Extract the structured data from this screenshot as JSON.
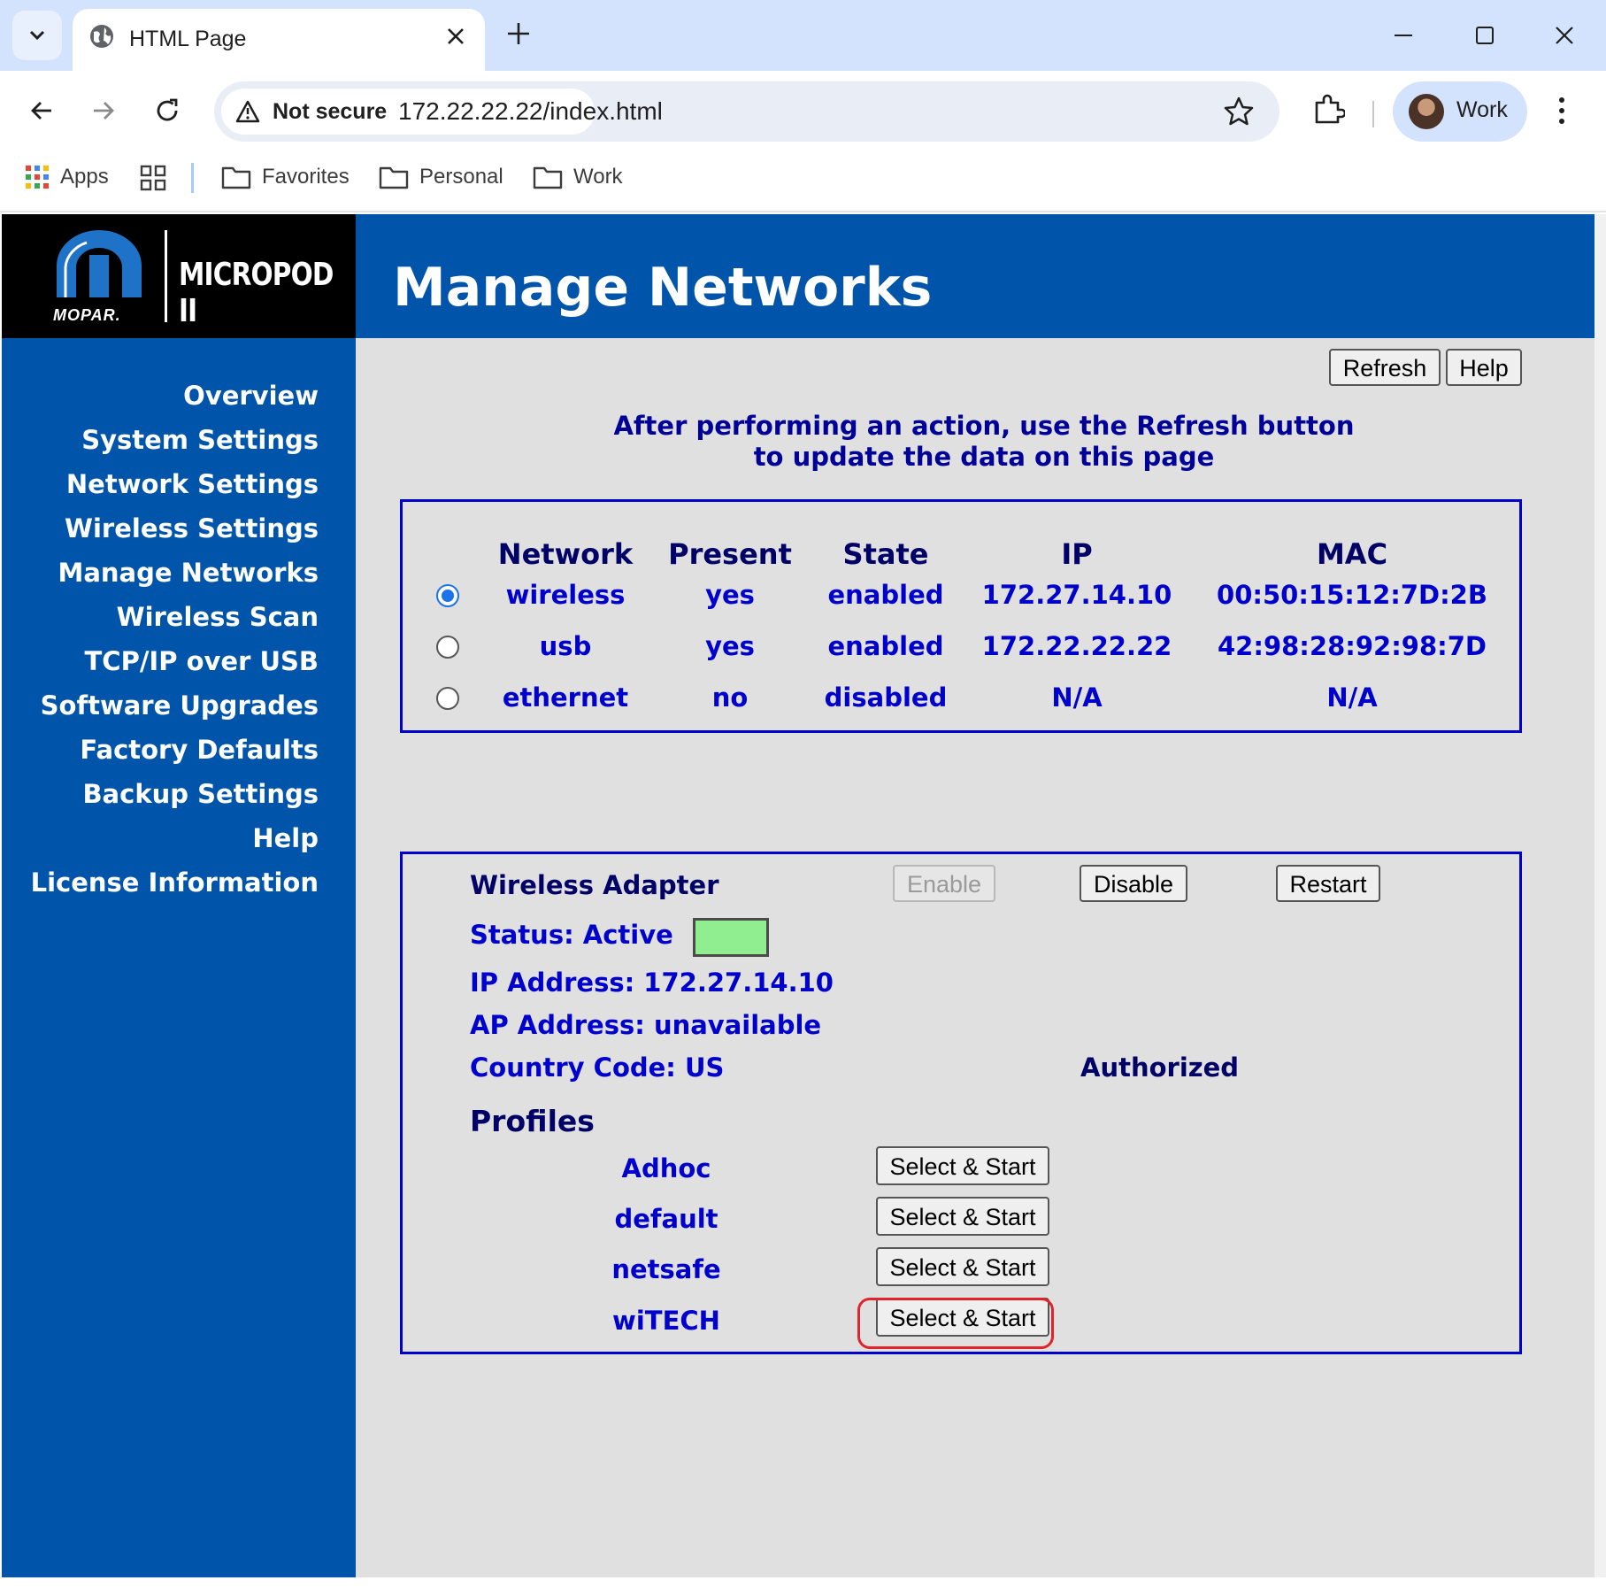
{
  "browser": {
    "tab_title": "HTML Page",
    "security_label": "Not secure",
    "url": "172.22.22.22/index.html",
    "profile_name": "Work",
    "bookmarks": [
      "Apps",
      "Favorites",
      "Personal",
      "Work"
    ]
  },
  "logo": {
    "brand": "MICROPOD II",
    "company": "MOPAR."
  },
  "header": {
    "title": "Manage Networks"
  },
  "sidebar": {
    "items": [
      {
        "label": "Overview"
      },
      {
        "label": "System Settings"
      },
      {
        "label": "Network Settings"
      },
      {
        "label": "Wireless Settings"
      },
      {
        "label": "Manage Networks"
      },
      {
        "label": "Wireless Scan"
      },
      {
        "label": "TCP/IP over USB"
      },
      {
        "label": "Software Upgrades"
      },
      {
        "label": "Factory Defaults"
      },
      {
        "label": "Backup Settings"
      },
      {
        "label": "Help"
      },
      {
        "label": "License Information"
      }
    ]
  },
  "actions": {
    "refresh_label": "Refresh",
    "help_label": "Help"
  },
  "notice": {
    "line1": "After performing an action, use the Refresh button",
    "line2": "to update the data on this page"
  },
  "networks": {
    "columns": [
      "Network",
      "Present",
      "State",
      "IP",
      "MAC"
    ],
    "rows": [
      {
        "network": "wireless",
        "present": "yes",
        "state": "enabled",
        "ip": "172.27.14.10",
        "mac": "00:50:15:12:7D:2B",
        "selected": true
      },
      {
        "network": "usb",
        "present": "yes",
        "state": "enabled",
        "ip": "172.22.22.22",
        "mac": "42:98:28:92:98:7D",
        "selected": false
      },
      {
        "network": "ethernet",
        "present": "no",
        "state": "disabled",
        "ip": "N/A",
        "mac": "N/A",
        "selected": false
      }
    ]
  },
  "adapter": {
    "title": "Wireless Adapter",
    "enable_label": "Enable",
    "disable_label": "Disable",
    "restart_label": "Restart",
    "status": "Status: Active",
    "status_color": "#90ee90",
    "ip_address": "IP Address: 172.27.14.10",
    "ap_address": "AP Address: unavailable",
    "country_code": "Country Code: US",
    "authorization": "Authorized",
    "profiles_heading": "Profiles",
    "profiles": [
      {
        "name": "Adhoc",
        "button": "Select & Start"
      },
      {
        "name": "default",
        "button": "Select & Start"
      },
      {
        "name": "netsafe",
        "button": "Select & Start"
      },
      {
        "name": "wiTECH",
        "button": "Select & Start"
      }
    ]
  },
  "colors": {
    "brand_blue": "#0055aa",
    "table_text": "#0000cc",
    "highlight": "#e0242b"
  }
}
